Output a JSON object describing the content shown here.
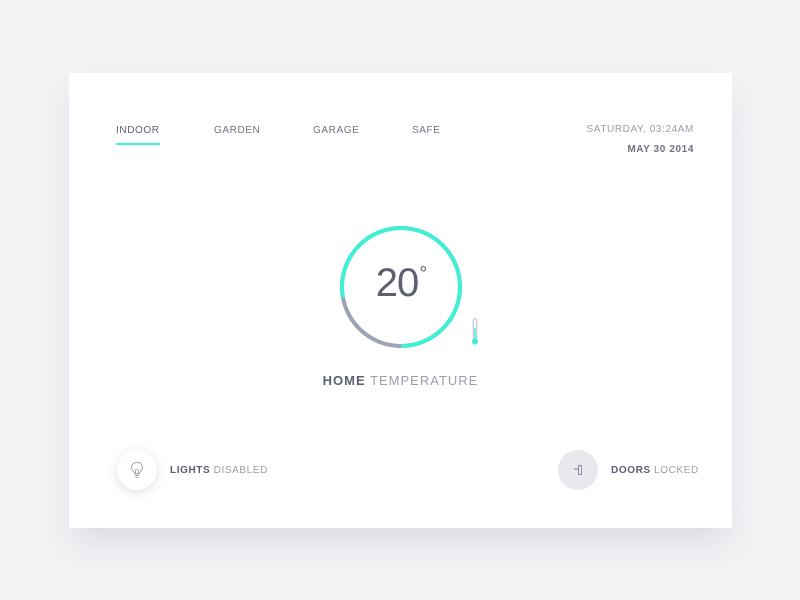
{
  "nav": {
    "tabs": [
      {
        "label": "INDOOR",
        "active": true
      },
      {
        "label": "GARDEN",
        "active": false
      },
      {
        "label": "GARAGE",
        "active": false
      },
      {
        "label": "SAFE",
        "active": false
      }
    ]
  },
  "datetime": {
    "day_time": "SATURDAY, 03:24AM",
    "date": "MAY 30 2014"
  },
  "thermostat": {
    "temperature": "20",
    "degree_symbol": "°",
    "label_strong": "HOME",
    "label_rest": "TEMPERATURE",
    "level_fraction": 0.78,
    "icon": "thermometer-icon"
  },
  "devices": {
    "lights": {
      "label_strong": "LIGHTS",
      "label_rest": "DISABLED",
      "icon": "lightbulb-icon"
    },
    "doors": {
      "label_strong": "DOORS",
      "label_rest": "LOCKED",
      "icon": "door-lock-icon"
    }
  },
  "colors": {
    "accent": "#3ff0d6",
    "track": "#9da3b4",
    "marker": "#e35b7a",
    "text_dark": "#5b5f70",
    "text_light": "#9a9dab",
    "background": "#f1f2f4",
    "card": "#ffffff"
  }
}
